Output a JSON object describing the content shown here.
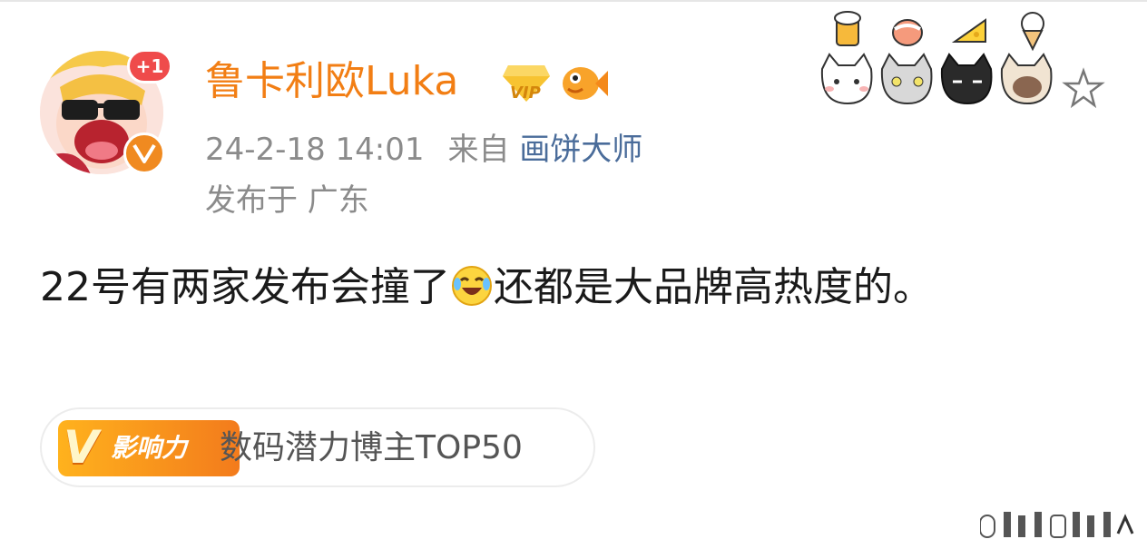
{
  "post": {
    "username": "鲁卡利欧Luka",
    "notification_count": "+1",
    "vip_badge_text": "VIP",
    "timestamp": "24-2-18 14:01",
    "source_prefix": "来自",
    "source_name": "画饼大师",
    "location": "发布于 广东",
    "content_part1": "22号有两家发布会撞了",
    "content_part2": "还都是大品牌高热度的。",
    "influence_badge": "影响力",
    "influence_v": "V",
    "influence_label": "数码潜力博主TOP50"
  },
  "icons": {
    "avatar": "avatar",
    "vip": "vip-diamond-icon",
    "fish": "fish-icon",
    "verified": "verified-badge-icon",
    "laugh": "laugh-cry-emoji-icon",
    "star": "star-icon",
    "decor": "cat-and-food-stickers"
  },
  "colors": {
    "username": "#f27e14",
    "meta": "#8b8b8b",
    "source": "#4a6c9a",
    "badge_red": "#ef4b4b",
    "verified_orange": "#f08a20"
  }
}
